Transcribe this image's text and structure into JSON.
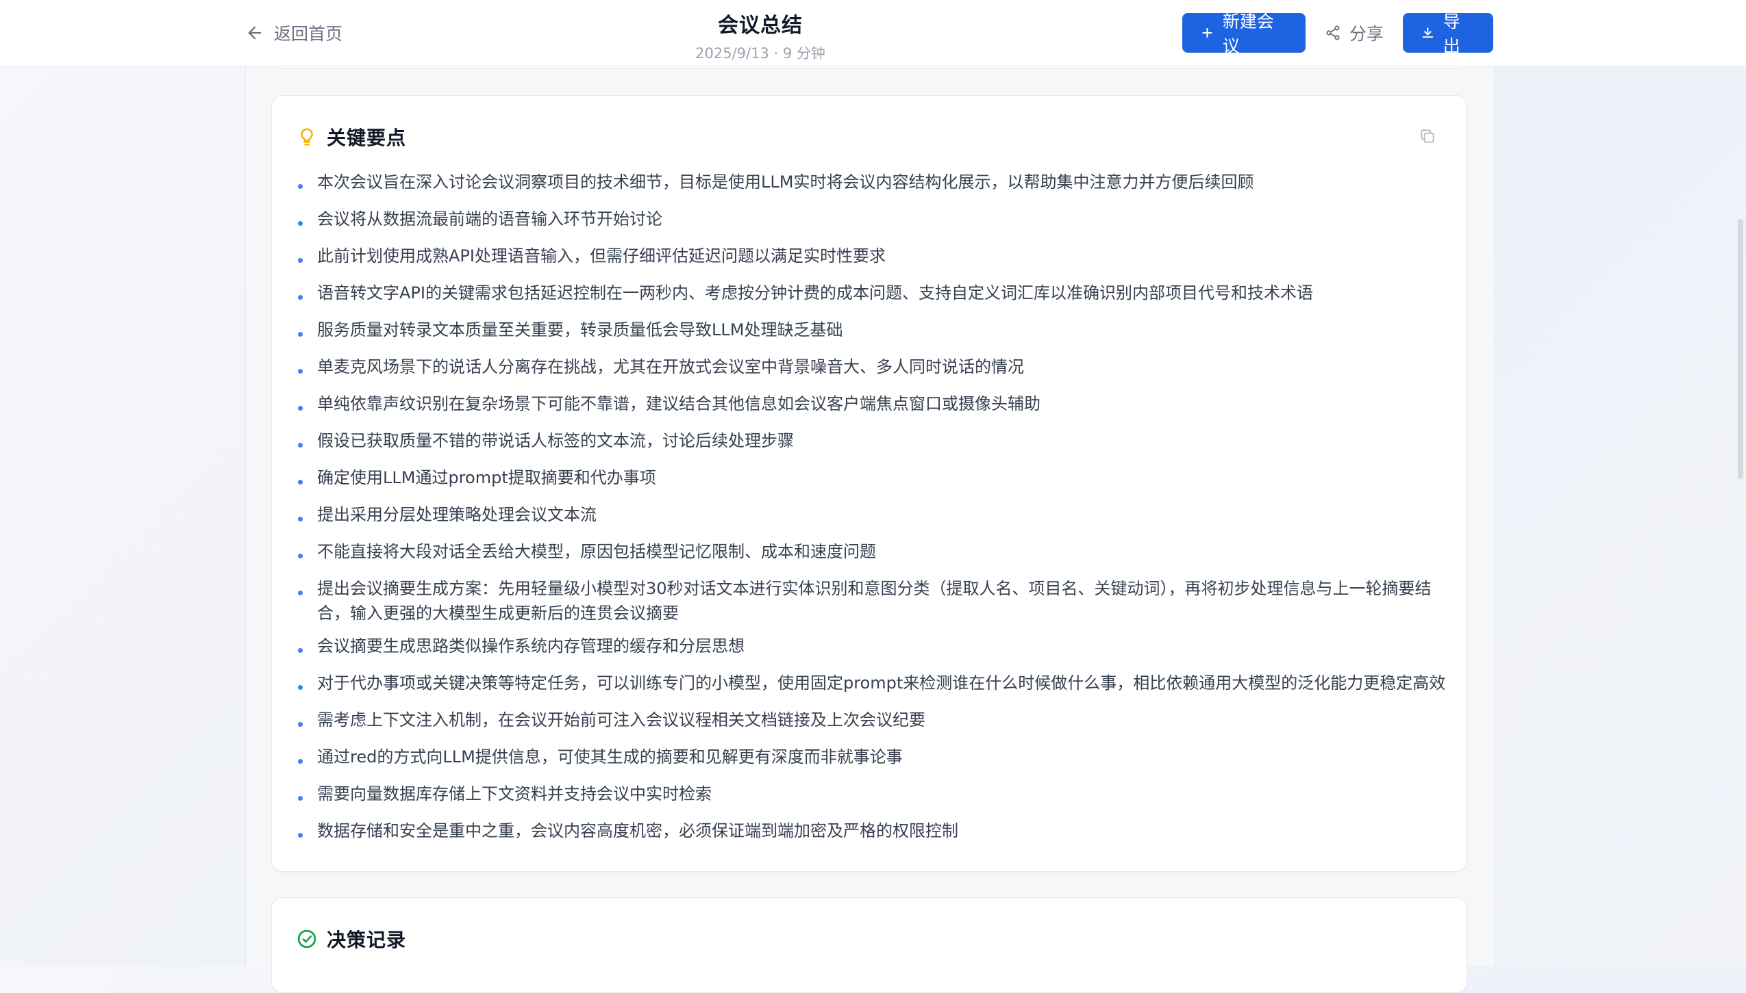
{
  "header": {
    "back_label": "返回首页",
    "title": "会议总结",
    "subtitle": "2025/9/13 · 9 分钟",
    "new_meeting_label": "新建会议",
    "share_label": "分享",
    "export_label": "导出"
  },
  "colors": {
    "accent": "#1e63e0",
    "bullet": "#3b82f6",
    "lightbulb": "#f5b301",
    "check": "#16a34a"
  },
  "key_points": {
    "title": "关键要点",
    "items": [
      "本次会议旨在深入讨论会议洞察项目的技术细节，目标是使用LLM实时将会议内容结构化展示，以帮助集中注意力并方便后续回顾",
      "会议将从数据流最前端的语音输入环节开始讨论",
      "此前计划使用成熟API处理语音输入，但需仔细评估延迟问题以满足实时性要求",
      "语音转文字API的关键需求包括延迟控制在一两秒内、考虑按分钟计费的成本问题、支持自定义词汇库以准确识别内部项目代号和技术术语",
      "服务质量对转录文本质量至关重要，转录质量低会导致LLM处理缺乏基础",
      "单麦克风场景下的说话人分离存在挑战，尤其在开放式会议室中背景噪音大、多人同时说话的情况",
      "单纯依靠声纹识别在复杂场景下可能不靠谱，建议结合其他信息如会议客户端焦点窗口或摄像头辅助",
      "假设已获取质量不错的带说话人标签的文本流，讨论后续处理步骤",
      "确定使用LLM通过prompt提取摘要和代办事项",
      "提出采用分层处理策略处理会议文本流",
      "不能直接将大段对话全丢给大模型，原因包括模型记忆限制、成本和速度问题",
      "提出会议摘要生成方案：先用轻量级小模型对30秒对话文本进行实体识别和意图分类（提取人名、项目名、关键动词），再将初步处理信息与上一轮摘要结合，输入更强的大模型生成更新后的连贯会议摘要",
      "会议摘要生成思路类似操作系统内存管理的缓存和分层思想",
      "对于代办事项或关键决策等特定任务，可以训练专门的小模型，使用固定prompt来检测谁在什么时候做什么事，相比依赖通用大模型的泛化能力更稳定高效",
      "需考虑上下文注入机制，在会议开始前可注入会议议程相关文档链接及上次会议纪要",
      "通过red的方式向LLM提供信息，可使其生成的摘要和见解更有深度而非就事论事",
      "需要向量数据库存储上下文资料并支持会议中实时检索",
      "数据存储和安全是重中之重，会议内容高度机密，必须保证端到端加密及严格的权限控制"
    ]
  },
  "decisions": {
    "title": "决策记录"
  }
}
